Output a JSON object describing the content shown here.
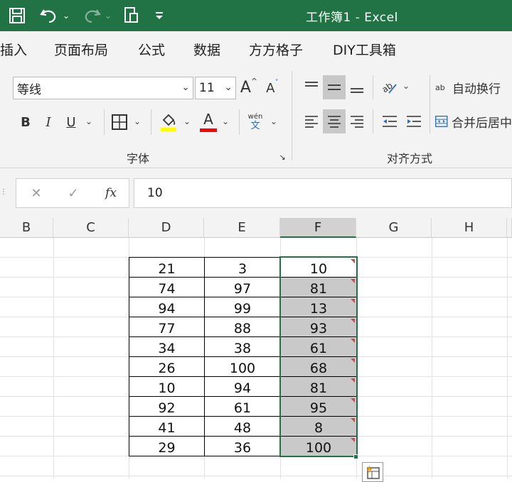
{
  "window": {
    "title": "工作簿1  -  Excel",
    "accent": "#217346"
  },
  "quick_access": [
    {
      "name": "save-icon",
      "glyph": "🖫"
    },
    {
      "name": "undo-icon",
      "glyph": "↶"
    },
    {
      "name": "redo-icon",
      "glyph": "↷"
    },
    {
      "name": "touch-mode-icon",
      "glyph": "🖐"
    },
    {
      "name": "customize-qat-icon",
      "glyph": "⩡"
    }
  ],
  "tabs": [
    "插入",
    "页面布局",
    "公式",
    "数据",
    "方方格子",
    "DIY工具箱"
  ],
  "font_group": {
    "font_name": "等线",
    "font_size": "11",
    "grow_label": "A",
    "shrink_label": "A",
    "bold": "B",
    "italic": "I",
    "underline": "U",
    "font_color_label": "A",
    "phonetic_top": "wén",
    "phonetic_bottom": "文",
    "label": "字体"
  },
  "align_group": {
    "wrap_label": "自动换行",
    "merge_label": "合并后居中",
    "wrap_icon_text": "ab",
    "label": "对齐方式"
  },
  "formula_bar": {
    "cancel": "✕",
    "enter": "✓",
    "fx": "fx",
    "value": "10"
  },
  "columns": [
    "B",
    "C",
    "D",
    "E",
    "F",
    "G",
    "H"
  ],
  "table": {
    "rows": [
      [
        "21",
        "3",
        "10"
      ],
      [
        "74",
        "97",
        "81"
      ],
      [
        "94",
        "99",
        "13"
      ],
      [
        "77",
        "88",
        "93"
      ],
      [
        "34",
        "38",
        "61"
      ],
      [
        "26",
        "100",
        "68"
      ],
      [
        "10",
        "94",
        "81"
      ],
      [
        "92",
        "61",
        "95"
      ],
      [
        "41",
        "48",
        "8"
      ],
      [
        "29",
        "36",
        "100"
      ]
    ]
  }
}
